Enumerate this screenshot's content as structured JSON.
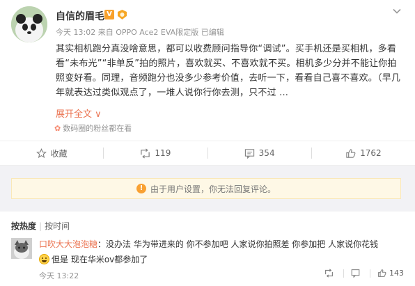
{
  "post": {
    "username": "自信的眉毛",
    "verified_badge": "V",
    "meta": "今天 13:02 来自 OPPO Ace2 EVA限定版 已编辑",
    "text": "其实相机跑分真没啥意思，都可以收费顾问指导你“调试”。买手机还是买相机，多看看“未布光”“非单反”拍的照片，喜欢就买、不喜欢就不买。相机多少分并不能让你拍照变好看。同理，音频跑分也没多少参考价值，去听一下，看看自己喜不喜欢。（早几年就表达过类似观点了，一堆人说你行你去测，只不过 ...",
    "expand_label": "展开全文 ∨",
    "fans_note": "数码圈的粉丝都在看",
    "icons": {
      "avatar": "panda-avatar",
      "more": "chevron-down-icon",
      "fans": "flower-icon"
    }
  },
  "actions": {
    "favorite_label": "收藏",
    "repost_count": "119",
    "comment_count": "354",
    "like_count": "1762"
  },
  "notice": {
    "text": "由于用户设置，你无法回复评论。",
    "icon": "warning-icon"
  },
  "sort": {
    "hot_label": "按热度",
    "separator": "|",
    "time_label": "按时间"
  },
  "comment": {
    "user": "口吹大大泡泡糖",
    "text": "：没办法 华为带进来的 你不参加吧 人家说你拍照差 你参加把 人家说你花钱",
    "text2": "但是 现在华米ov都参加了",
    "time": "今天 13:22",
    "like_count": "143"
  },
  "colors": {
    "accent": "#eb7350",
    "badge_orange": "#f8a12c",
    "notice_bg": "#fef8e6",
    "gray_text": "#939393"
  }
}
